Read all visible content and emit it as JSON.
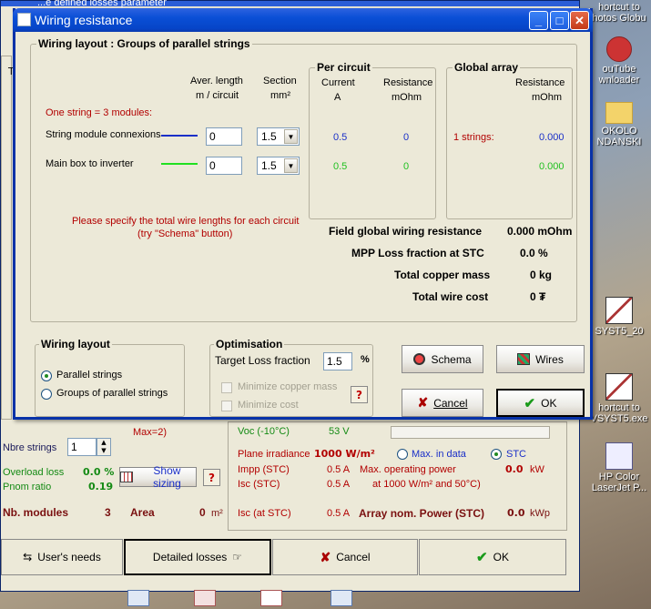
{
  "desktop": {
    "icons": [
      {
        "label": "hortcut to\nhotos Globu"
      },
      {
        "label": "ouTube\nwnloader"
      },
      {
        "label": "OKOLO\nNDANSKI"
      },
      {
        "label": "SYST5_20"
      },
      {
        "label": "hortcut to\nVSYST5.exe"
      },
      {
        "label": "HP Color\nLaserJet P..."
      }
    ]
  },
  "background_window": {
    "title_fragment": "...e defined losses parameter",
    "side_letter": "T",
    "voc_label": "Voc (-10°C)",
    "voc_value": "53 V",
    "max_label": "Max=2)",
    "nbre_strings_label": "Nbre strings",
    "nbre_strings_value": "1",
    "overload_loss_label": "Overload loss",
    "overload_loss_value": "0.0 %",
    "pnom_ratio_label": "Pnom ratio",
    "pnom_ratio_value": "0.19",
    "show_sizing_label": "Show sizing",
    "nb_modules_label": "Nb. modules",
    "nb_modules_value": "3",
    "area_label": "Area",
    "area_value": "0",
    "area_unit": "m²",
    "plane_irradiance_label": "Plane irradiance",
    "plane_irradiance_value": "1000 W/m²",
    "max_in_data_label": "Max. in data",
    "stc_label": "STC",
    "impp_label": "Impp (STC)",
    "impp_value": "0.5 A",
    "max_op_power_label": "Max. operating power",
    "max_op_power_value": "0.0",
    "max_op_power_unit": "kW",
    "isc_label": "Isc  (STC)",
    "isc_value": "0.5 A",
    "at_conditions_label": "at 1000 W/m² and 50°C)",
    "isc_at_stc_label": "Isc (at STC)",
    "isc_at_stc_value": "0.5 A",
    "array_nom_power_label": "Array nom. Power (STC)",
    "array_nom_power_value": "0.0",
    "array_nom_power_unit": "kWp",
    "users_needs_label": "User's needs",
    "detailed_losses_label": "Detailed losses",
    "cancel_label": "Cancel",
    "ok_label": "OK"
  },
  "dialog": {
    "title": "Wiring resistance",
    "layout_group_title": "Wiring layout :   Groups of parallel strings",
    "aver_length_header": "Aver. length",
    "aver_length_unit": "m / circuit",
    "section_header": "Section",
    "section_unit": "mm²",
    "one_string_label": "One string =   3 modules:",
    "rows": [
      {
        "label": "String module connexions",
        "length": "0",
        "section": "1.5",
        "current": "0.5",
        "resistance": "0",
        "global_strings": "1 strings:",
        "global_resistance": "0.000"
      },
      {
        "label": "Main box to inverter",
        "length": "0",
        "section": "1.5",
        "current": "0.5",
        "resistance": "0",
        "global_strings": "",
        "global_resistance": "0.000"
      }
    ],
    "per_circuit_title": "Per circuit",
    "current_header": "Current",
    "current_unit": "A",
    "resistance_header": "Resistance",
    "resistance_unit": "mOhm",
    "global_array_title": "Global array",
    "global_resistance_header": "Resistance",
    "global_resistance_unit": "mOhm",
    "hint_line1": "Please specify the total wire lengths for each circuit",
    "hint_line2": "(try  \"Schema\" button)",
    "field_global_label": "Field global wiring resistance",
    "field_global_value": "0.000 mOhm",
    "mpp_loss_label": "MPP Loss fraction at  STC",
    "mpp_loss_value": "0.0  %",
    "copper_mass_label": "Total copper mass",
    "copper_mass_value": "0 kg",
    "wire_cost_label": "Total wire cost",
    "wire_cost_value": "0 ₮",
    "wiring_layout_title": "Wiring layout",
    "radio_parallel": "Parallel strings",
    "radio_groups": "Groups of parallel strings",
    "optimisation_title": "Optimisation",
    "target_loss_label": "Target Loss fraction",
    "target_loss_value": "1.5",
    "target_loss_unit": "%",
    "minimize_copper_label": "Minimize copper mass",
    "minimize_cost_label": "Minimize cost",
    "schema_label": "Schema",
    "wires_label": "Wires",
    "cancel_label": "Cancel",
    "ok_label": "OK",
    "colors": {
      "string_line": "#1a2fc8",
      "main_line": "#20e020"
    }
  }
}
